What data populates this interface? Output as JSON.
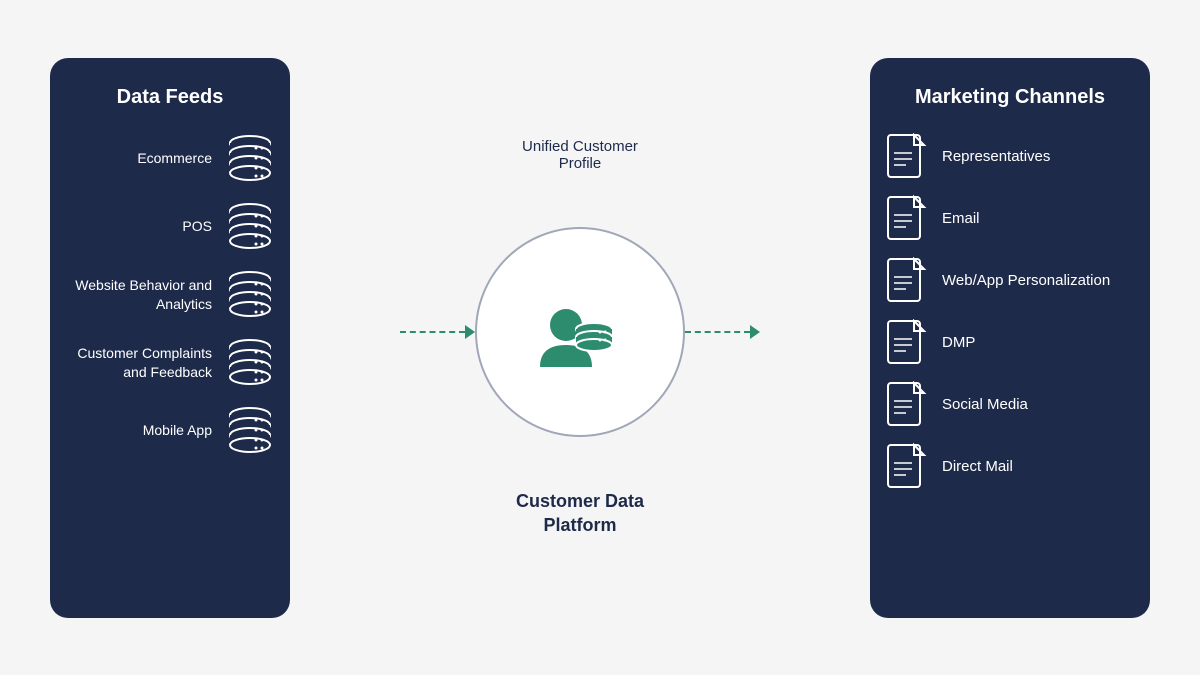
{
  "left_panel": {
    "title": "Data Feeds",
    "items": [
      {
        "label": "Ecommerce"
      },
      {
        "label": "POS"
      },
      {
        "label": "Website Behavior and Analytics"
      },
      {
        "label": "Customer Complaints and Feedback"
      },
      {
        "label": "Mobile App"
      }
    ]
  },
  "right_panel": {
    "title": "Marketing Channels",
    "items": [
      {
        "label": "Representatives"
      },
      {
        "label": "Email"
      },
      {
        "label": "Web/App Personalization"
      },
      {
        "label": "DMP"
      },
      {
        "label": "Social Media"
      },
      {
        "label": "Direct Mail"
      }
    ]
  },
  "center": {
    "circle_label": "Unified Customer\nProfile",
    "bottom_label": "Customer Data\nPlatform"
  },
  "colors": {
    "panel_bg": "#1e2a4a",
    "accent": "#2d8c6e",
    "text_dark": "#1e2a4a"
  }
}
